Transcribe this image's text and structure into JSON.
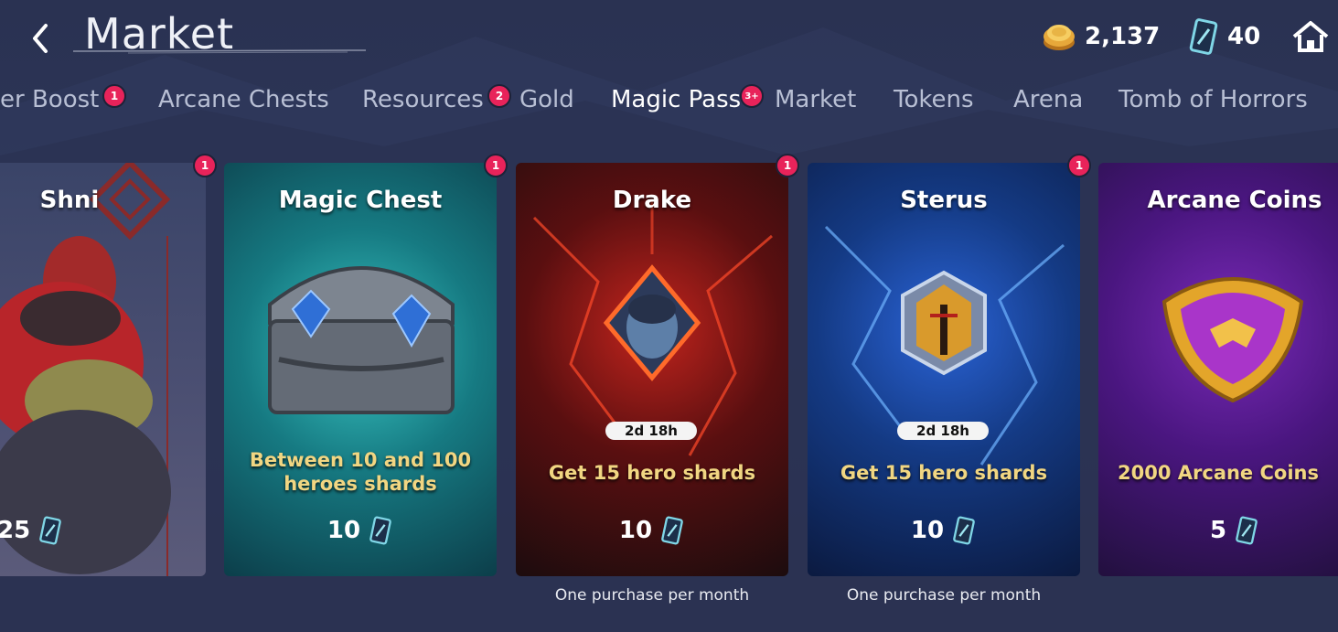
{
  "header": {
    "title": "Market",
    "gold": "2,137",
    "gems": "40"
  },
  "tabs": [
    {
      "label": "er Boost",
      "badge": "1"
    },
    {
      "label": "Arcane Chests",
      "badge": ""
    },
    {
      "label": "Resources",
      "badge": "2"
    },
    {
      "label": "Gold",
      "badge": ""
    },
    {
      "label": "Magic Pass",
      "badge": "3+"
    },
    {
      "label": "Market",
      "badge": ""
    },
    {
      "label": "Tokens",
      "badge": ""
    },
    {
      "label": "Arena",
      "badge": ""
    },
    {
      "label": "Tomb of Horrors",
      "badge": ""
    }
  ],
  "active_tab": "Magic Pass",
  "cards": [
    {
      "title": "Shni",
      "desc": "",
      "price": "25",
      "badge": "1",
      "timer": "",
      "note": ""
    },
    {
      "title": "Magic Chest",
      "desc": "Between 10 and 100 heroes shards",
      "price": "10",
      "badge": "1",
      "timer": "",
      "note": ""
    },
    {
      "title": "Drake",
      "desc": "Get 15 hero shards",
      "price": "10",
      "badge": "1",
      "timer": "2d 18h",
      "note": "One purchase per month"
    },
    {
      "title": "Sterus",
      "desc": "Get 15 hero shards",
      "price": "10",
      "badge": "1",
      "timer": "2d 18h",
      "note": "One purchase per month"
    },
    {
      "title": "Arcane Coins",
      "desc": "2000 Arcane Coins",
      "price": "5",
      "badge": "",
      "timer": "",
      "note": ""
    }
  ],
  "colors": {
    "accent_badge": "#e8235a",
    "desc_text": "#f1d682",
    "background": "#2b3354"
  },
  "icons": {
    "back": "chevron-left-icon",
    "gold": "gold-coin-icon",
    "gem": "gem-card-icon",
    "home": "home-icon"
  }
}
